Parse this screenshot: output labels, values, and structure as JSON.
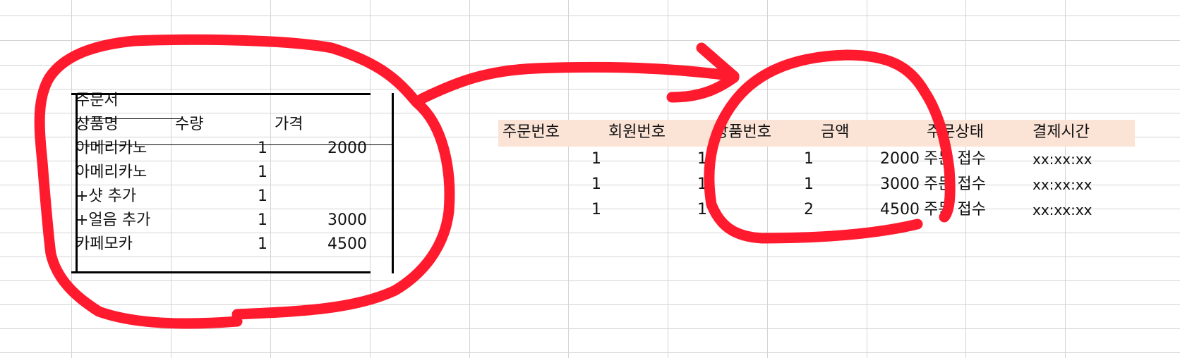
{
  "order_form": {
    "title": "주문서",
    "headers": [
      "상품명",
      "수량",
      "가격"
    ],
    "rows": [
      {
        "name": "아메리카노",
        "qty": "1",
        "price": "2000"
      },
      {
        "name": "아메리카노",
        "qty": "1",
        "price": ""
      },
      {
        "name": "+샷 추가",
        "qty": "1",
        "price": ""
      },
      {
        "name": "+얼음 추가",
        "qty": "1",
        "price": "3000"
      },
      {
        "name": "카페모카",
        "qty": "1",
        "price": "4500"
      }
    ]
  },
  "orders_table": {
    "headers": [
      "주문번호",
      "회원번호",
      "상품번호",
      "금액",
      "주문상태",
      "결제시간"
    ],
    "header_fill": "#fbe3d6",
    "rows": [
      [
        "1",
        "1",
        "1",
        "2000",
        "주문 접수",
        "xx:xx:xx"
      ],
      [
        "1",
        "1",
        "1",
        "3000",
        "주문 접수",
        "xx:xx:xx"
      ],
      [
        "1",
        "1",
        "2",
        "4500",
        "주문 접수",
        "xx:xx:xx"
      ]
    ]
  },
  "annotation": {
    "stroke_color": "#ff1a2e",
    "shapes": [
      "circle-around-order-form",
      "arrow-to-orders-table",
      "circle-around-product-and-amount-columns"
    ]
  }
}
